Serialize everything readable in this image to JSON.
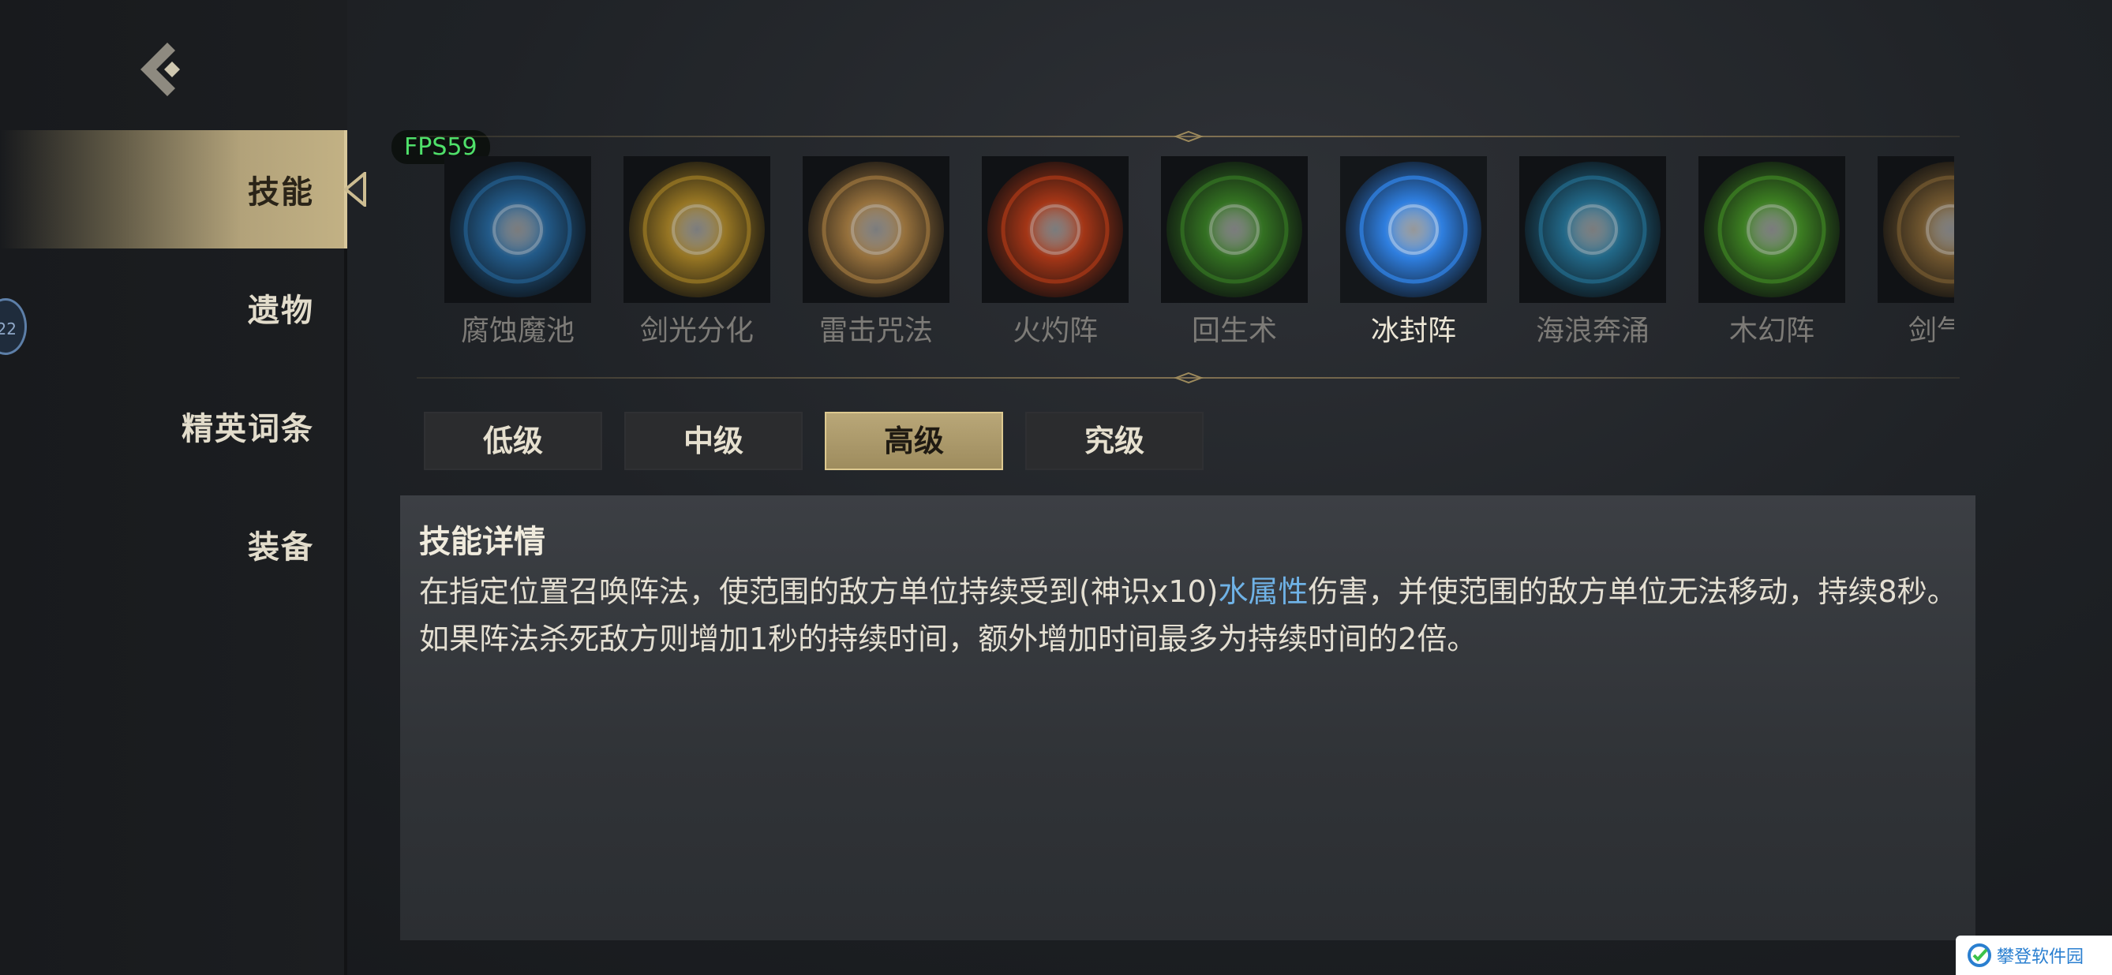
{
  "hud": {
    "fps": "FPS59"
  },
  "sidebar": {
    "items": [
      {
        "label": "技能",
        "active": true
      },
      {
        "label": "遗物",
        "active": false
      },
      {
        "label": "精英词条",
        "active": false
      },
      {
        "label": "装备",
        "active": false
      }
    ],
    "badge": "22"
  },
  "skills": [
    {
      "name": "腐蚀魔池",
      "icon": "corrosion-pool-icon",
      "color": "#2b6fa8"
    },
    {
      "name": "剑光分化",
      "icon": "sword-light-icon",
      "color": "#b8902c"
    },
    {
      "name": "雷击咒法",
      "icon": "lightning-curse-icon",
      "color": "#b88a4a"
    },
    {
      "name": "火灼阵",
      "icon": "fire-array-icon",
      "color": "#c8421c"
    },
    {
      "name": "回生术",
      "icon": "revival-icon",
      "color": "#3f8a2a"
    },
    {
      "name": "冰封阵",
      "icon": "ice-array-icon",
      "color": "#2f7fe0",
      "selected": true
    },
    {
      "name": "海浪奔涌",
      "icon": "ocean-wave-icon",
      "color": "#2a7fa6"
    },
    {
      "name": "木幻阵",
      "icon": "wood-illusion-icon",
      "color": "#4a9a2a"
    },
    {
      "name": "剑气诀",
      "icon": "sword-qi-icon",
      "color": "#8a6a3a"
    }
  ],
  "tiers": [
    {
      "label": "低级",
      "active": false
    },
    {
      "label": "中级",
      "active": false
    },
    {
      "label": "高级",
      "active": true
    },
    {
      "label": "究级",
      "active": false
    }
  ],
  "detail": {
    "title": "技能详情",
    "desc_before": "在指定位置召唤阵法，使范围的敌方单位持续受到(神识x10)",
    "desc_highlight": "水属性",
    "desc_after": "伤害，并使范围的敌方单位无法移动，持续8秒。如果阵法杀死敌方则增加1秒的持续时间，额外增加时间最多为持续时间的2倍。",
    "highlight_color": "#6fb2e6"
  },
  "watermark": {
    "text": "攀登软件园"
  }
}
